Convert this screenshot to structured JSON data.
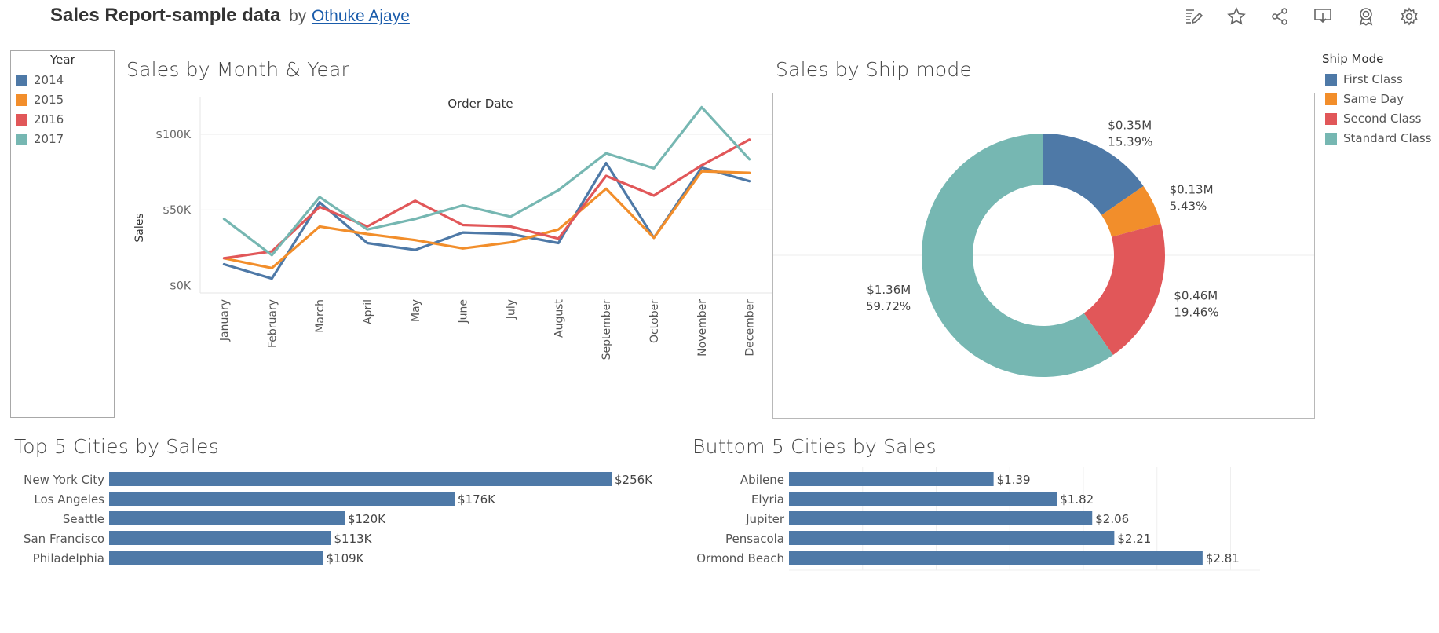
{
  "header": {
    "title": "Sales Report-sample data",
    "by": "by",
    "author": "Othuke Ajaye",
    "icons": [
      "edit-icon",
      "star-icon",
      "share-icon",
      "download-icon",
      "badge-icon",
      "settings-icon"
    ]
  },
  "year_legend": {
    "title": "Year",
    "items": [
      {
        "label": "2014",
        "color": "#4e79a7"
      },
      {
        "label": "2015",
        "color": "#f28e2b"
      },
      {
        "label": "2016",
        "color": "#e15759"
      },
      {
        "label": "2017",
        "color": "#76b7b2"
      }
    ]
  },
  "ship_legend": {
    "title": "Ship Mode",
    "items": [
      {
        "label": "First Class",
        "color": "#4e79a7"
      },
      {
        "label": "Same Day",
        "color": "#f28e2b"
      },
      {
        "label": "Second Class",
        "color": "#e15759"
      },
      {
        "label": "Standard Class",
        "color": "#76b7b2"
      }
    ]
  },
  "sheets": {
    "line_title": "Sales by Month & Year",
    "donut_title": "Sales by Ship mode",
    "top5_title": "Top 5 Cities by Sales",
    "bottom5_title": "Buttom 5 Cities by Sales"
  },
  "chart_data": [
    {
      "type": "line",
      "title": "Sales by Month & Year",
      "xlabel": "Order Date",
      "ylabel": "Sales",
      "categories": [
        "January",
        "February",
        "March",
        "April",
        "May",
        "June",
        "July",
        "August",
        "September",
        "October",
        "November",
        "December"
      ],
      "yticks": [
        0,
        50000,
        100000
      ],
      "ytick_labels": [
        "$0K",
        "$50K",
        "$100K"
      ],
      "ylim": [
        -5000,
        125000
      ],
      "grid": true,
      "series": [
        {
          "name": "2014",
          "color": "#4e79a7",
          "values": [
            14000,
            4500,
            55000,
            28000,
            23500,
            35000,
            34000,
            28000,
            81000,
            31500,
            78000,
            69000
          ]
        },
        {
          "name": "2015",
          "color": "#f28e2b",
          "values": [
            18000,
            11500,
            39000,
            34000,
            30000,
            24500,
            28500,
            37000,
            64000,
            31500,
            75500,
            74500
          ]
        },
        {
          "name": "2016",
          "color": "#e15759",
          "values": [
            18000,
            22500,
            52000,
            39000,
            56000,
            40000,
            39000,
            31000,
            72500,
            59500,
            79500,
            96500
          ]
        },
        {
          "name": "2017",
          "color": "#76b7b2",
          "values": [
            44000,
            20000,
            58500,
            37000,
            44000,
            53000,
            45500,
            63000,
            87500,
            77500,
            118000,
            83500
          ]
        }
      ]
    },
    {
      "type": "pie",
      "title": "Sales by Ship mode",
      "donut": true,
      "slices": [
        {
          "name": "First Class",
          "value": 0.35,
          "percent": 15.39,
          "value_label": "$0.35M",
          "percent_label": "15.39%",
          "color": "#4e79a7"
        },
        {
          "name": "Same Day",
          "value": 0.13,
          "percent": 5.43,
          "value_label": "$0.13M",
          "percent_label": "5.43%",
          "color": "#f28e2b"
        },
        {
          "name": "Second Class",
          "value": 0.46,
          "percent": 19.46,
          "value_label": "$0.46M",
          "percent_label": "19.46%",
          "color": "#e15759"
        },
        {
          "name": "Standard Class",
          "value": 1.36,
          "percent": 59.72,
          "value_label": "$1.36M",
          "percent_label": "59.72%",
          "color": "#76b7b2"
        }
      ]
    },
    {
      "type": "bar",
      "orientation": "horizontal",
      "title": "Top 5 Cities by Sales",
      "categories": [
        "New York City",
        "Los Angeles",
        "Seattle",
        "San Francisco",
        "Philadelphia"
      ],
      "values": [
        256000,
        176000,
        120000,
        113000,
        109000
      ],
      "value_labels": [
        "$256K",
        "$176K",
        "$120K",
        "$113K",
        "$109K"
      ],
      "xlim": [
        0,
        256000
      ],
      "color": "#4e79a7"
    },
    {
      "type": "bar",
      "orientation": "horizontal",
      "title": "Buttom 5 Cities by Sales",
      "categories": [
        "Abilene",
        "Elyria",
        "Jupiter",
        "Pensacola",
        "Ormond Beach"
      ],
      "values": [
        1.39,
        1.82,
        2.06,
        2.21,
        2.81
      ],
      "value_labels": [
        "$1.39",
        "$1.82",
        "$2.06",
        "$2.21",
        "$2.81"
      ],
      "xlim": [
        0,
        3.2
      ],
      "grid": true,
      "color": "#4e79a7"
    }
  ]
}
